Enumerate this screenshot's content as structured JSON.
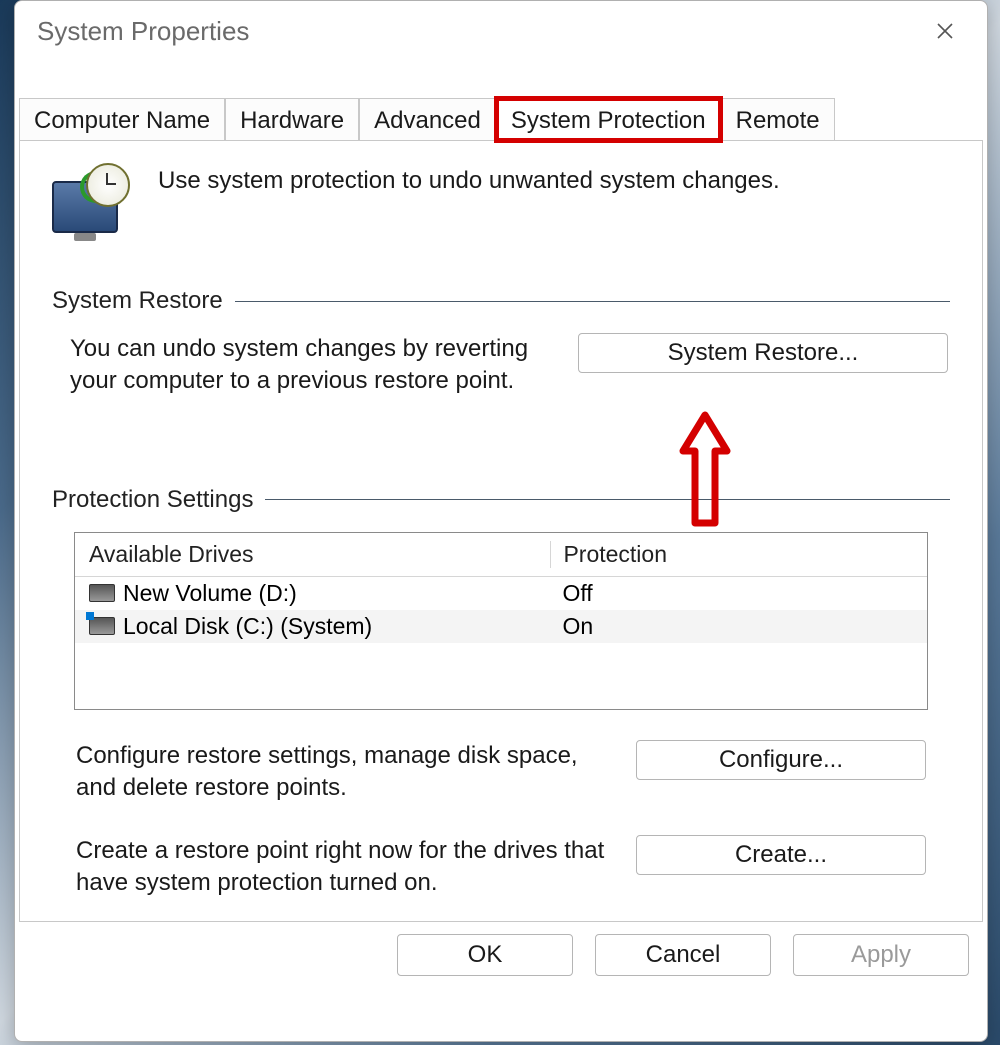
{
  "window": {
    "title": "System Properties"
  },
  "tabs": {
    "computer_name": "Computer Name",
    "hardware": "Hardware",
    "advanced": "Advanced",
    "system_protection": "System Protection",
    "remote": "Remote"
  },
  "intro": "Use system protection to undo unwanted system changes.",
  "sections": {
    "system_restore": {
      "title": "System Restore",
      "text": "You can undo system changes by reverting your computer to a previous restore point.",
      "button": "System Restore..."
    },
    "protection_settings": {
      "title": "Protection Settings",
      "columns": {
        "drives": "Available Drives",
        "protection": "Protection"
      },
      "rows": [
        {
          "name": "New Volume (D:)",
          "protection": "Off",
          "system": false
        },
        {
          "name": "Local Disk (C:) (System)",
          "protection": "On",
          "system": true
        }
      ],
      "configure_text": "Configure restore settings, manage disk space, and delete restore points.",
      "configure_button": "Configure...",
      "create_text": "Create a restore point right now for the drives that have system protection turned on.",
      "create_button": "Create..."
    }
  },
  "buttons": {
    "ok": "OK",
    "cancel": "Cancel",
    "apply": "Apply"
  },
  "annotation": {
    "highlight_tab": "system_protection",
    "arrow_points_to": "system_restore_button",
    "arrow_color": "#d40000"
  }
}
